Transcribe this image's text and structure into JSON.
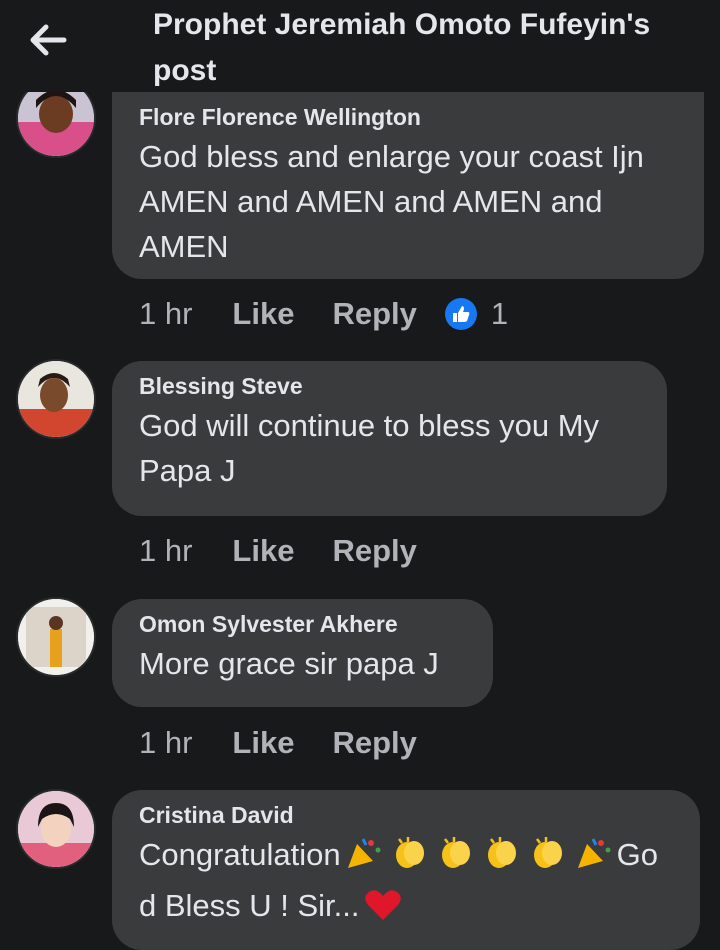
{
  "header": {
    "title": "Prophet Jeremiah Omoto Fufeyin's post",
    "back_icon": "arrow-left-icon"
  },
  "colors": {
    "background": "#18191a",
    "bubble": "#3a3b3c",
    "text": "#e4e6eb",
    "muted": "#b0b3b8",
    "like_badge": "#1877f2"
  },
  "comments": [
    {
      "author": "Flore Florence Wellington",
      "text": "God bless and enlarge your coast Ijn AMEN and AMEN and AMEN and AMEN",
      "time": "1 hr",
      "like_label": "Like",
      "reply_label": "Reply",
      "reaction_count": "1"
    },
    {
      "author": "Blessing Steve",
      "text": "God will continue to bless you My Papa J",
      "time": "1 hr",
      "like_label": "Like",
      "reply_label": "Reply"
    },
    {
      "author": "Omon Sylvester Akhere",
      "text": "More grace sir papa J",
      "time": "1 hr",
      "like_label": "Like",
      "reply_label": "Reply"
    },
    {
      "author": "Cristina David",
      "text_part1": "Congratulation",
      "text_part2": "Go",
      "text_part3": "d Bless U ! Sir...",
      "emojis": [
        "party-popper-icon",
        "clapping-hands-icon",
        "clapping-hands-icon",
        "clapping-hands-icon",
        "clapping-hands-icon",
        "party-popper-icon",
        "red-heart-icon"
      ]
    }
  ]
}
